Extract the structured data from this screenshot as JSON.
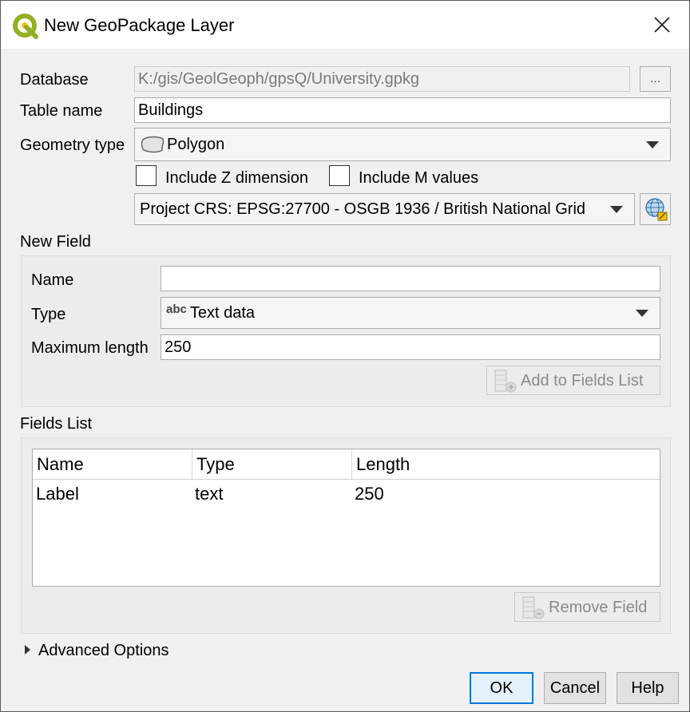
{
  "window": {
    "title": "New GeoPackage Layer",
    "close_glyph": "✕"
  },
  "form": {
    "database_label": "Database",
    "database_value": "K:/gis/GeolGeoph/gpsQ/University.gpkg",
    "browse_label": "...",
    "table_name_label": "Table name",
    "table_name_value": "Buildings",
    "geometry_type_label": "Geometry type",
    "geometry_type_value": "Polygon",
    "include_z_label": "Include Z dimension",
    "include_z_checked": false,
    "include_m_label": "Include M values",
    "include_m_checked": false,
    "crs_value": "Project CRS: EPSG:27700 - OSGB 1936 / British National Grid"
  },
  "new_field": {
    "section_label": "New Field",
    "name_label": "Name",
    "name_value": "",
    "type_label": "Type",
    "type_prefix": "abc",
    "type_value": "Text data",
    "max_length_label": "Maximum length",
    "max_length_value": "250",
    "add_button_label": "Add to Fields List"
  },
  "fields_list": {
    "section_label": "Fields List",
    "columns": [
      "Name",
      "Type",
      "Length"
    ],
    "rows": [
      {
        "name": "Label",
        "type": "text",
        "length": "250"
      }
    ],
    "remove_button_label": "Remove Field"
  },
  "advanced": {
    "label": "Advanced Options",
    "expanded": false
  },
  "footer": {
    "ok_label": "OK",
    "cancel_label": "Cancel",
    "help_label": "Help"
  },
  "colors": {
    "qgis_green": "#93b023",
    "accent_blue": "#0078d7"
  }
}
